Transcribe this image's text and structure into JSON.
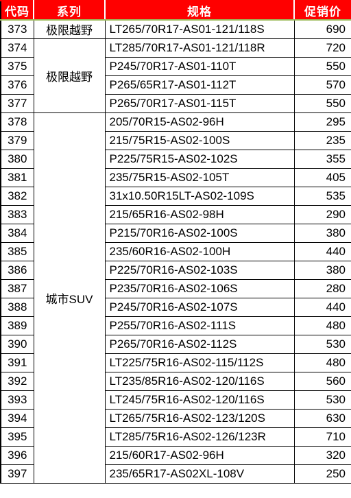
{
  "table": {
    "headers": [
      {
        "label": "代码",
        "key": "code",
        "align": "center"
      },
      {
        "label": "系列",
        "key": "series",
        "align": "center"
      },
      {
        "label": "规格",
        "key": "spec",
        "align": "left"
      },
      {
        "label": "促销价",
        "key": "price",
        "align": "right"
      }
    ],
    "header_bg": "#FF0000",
    "header_text_color": "#FFFFFF",
    "header_underline_color": "#9BBB59",
    "grid_color": "#000000",
    "rows": [
      {
        "code": "373",
        "series": "极限越野",
        "series_rowspan": 1,
        "spec": "LT265/70R17-AS01-121/118S",
        "price": "690"
      },
      {
        "code": "374",
        "series": "极限越野",
        "series_rowspan": 4,
        "spec": "LT285/70R17-AS01-121/118R",
        "price": "720"
      },
      {
        "code": "375",
        "series": null,
        "series_rowspan": 0,
        "spec": "P245/70R17-AS01-110T",
        "price": "550"
      },
      {
        "code": "376",
        "series": null,
        "series_rowspan": 0,
        "spec": "P265/65R17-AS01-112T",
        "price": "570"
      },
      {
        "code": "377",
        "series": null,
        "series_rowspan": 0,
        "spec": "P265/70R17-AS01-115T",
        "price": "550"
      },
      {
        "code": "378",
        "series": "城市SUV",
        "series_rowspan": 20,
        "spec": "205/70R15-AS02-96H",
        "price": "295"
      },
      {
        "code": "379",
        "series": null,
        "series_rowspan": 0,
        "spec": "215/75R15-AS02-100S",
        "price": "235"
      },
      {
        "code": "380",
        "series": null,
        "series_rowspan": 0,
        "spec": "P225/75R15-AS02-102S",
        "price": "355"
      },
      {
        "code": "381",
        "series": null,
        "series_rowspan": 0,
        "spec": "235/75R15-AS02-105T",
        "price": "405"
      },
      {
        "code": "382",
        "series": null,
        "series_rowspan": 0,
        "spec": "31x10.50R15LT-AS02-109S",
        "price": "535"
      },
      {
        "code": "383",
        "series": null,
        "series_rowspan": 0,
        "spec": "215/65R16-AS02-98H",
        "price": "290"
      },
      {
        "code": "384",
        "series": null,
        "series_rowspan": 0,
        "spec": "P215/70R16-AS02-100S",
        "price": "380"
      },
      {
        "code": "385",
        "series": null,
        "series_rowspan": 0,
        "spec": "235/60R16-AS02-100H",
        "price": "440"
      },
      {
        "code": "386",
        "series": null,
        "series_rowspan": 0,
        "spec": "P225/70R16-AS02-103S",
        "price": "380"
      },
      {
        "code": "387",
        "series": null,
        "series_rowspan": 0,
        "spec": "P235/70R16-AS02-106S",
        "price": "280"
      },
      {
        "code": "388",
        "series": null,
        "series_rowspan": 0,
        "spec": "P245/70R16-AS02-107S",
        "price": "440"
      },
      {
        "code": "389",
        "series": null,
        "series_rowspan": 0,
        "spec": "P255/70R16-AS02-111S",
        "price": "480"
      },
      {
        "code": "390",
        "series": null,
        "series_rowspan": 0,
        "spec": "P265/70R16-AS02-112S",
        "price": "530"
      },
      {
        "code": "391",
        "series": null,
        "series_rowspan": 0,
        "spec": "LT225/75R16-AS02-115/112S",
        "price": "480"
      },
      {
        "code": "392",
        "series": null,
        "series_rowspan": 0,
        "spec": "LT235/85R16-AS02-120/116S",
        "price": "560"
      },
      {
        "code": "393",
        "series": null,
        "series_rowspan": 0,
        "spec": "LT245/75R16-AS02-120/116S",
        "price": "530"
      },
      {
        "code": "394",
        "series": null,
        "series_rowspan": 0,
        "spec": "LT265/75R16-AS02-123/120S",
        "price": "630"
      },
      {
        "code": "395",
        "series": null,
        "series_rowspan": 0,
        "spec": "LT285/75R16-AS02-126/123R",
        "price": "710"
      },
      {
        "code": "396",
        "series": null,
        "series_rowspan": 0,
        "spec": "215/60R17-AS02-96H",
        "price": "320"
      },
      {
        "code": "397",
        "series": null,
        "series_rowspan": 0,
        "spec": "235/65R17-AS02XL-108V",
        "price": "250"
      }
    ]
  }
}
